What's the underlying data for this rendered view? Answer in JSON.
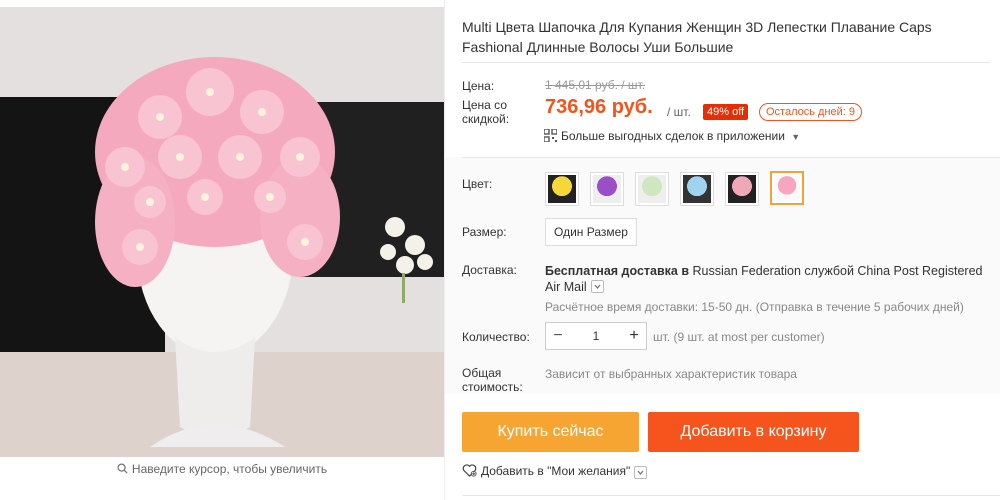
{
  "gallery": {
    "magnify_hint": "Наведите курсор, чтобы увеличить",
    "search_icon": "magnifier-icon"
  },
  "product": {
    "title": "Multi Цвета Шапочка Для Купания Женщин 3D Лепестки Плавание Caps Fashional Длинные Волосы Уши Большие"
  },
  "price": {
    "label_price": "Цена:",
    "old_price": "1 445,01 руб. / шт.",
    "label_discount_line1": "Цена со",
    "label_discount_line2": "скидкой:",
    "new_price": "736,96 руб.",
    "per_unit": "/ шт.",
    "discount_badge": "49% off",
    "days_left": "Осталось дней: 9",
    "app_deals": "Больше выгодных сделок в приложении"
  },
  "options": {
    "color_label": "Цвет:",
    "swatches": [
      {
        "name": "yellow",
        "color": "#f5d73a"
      },
      {
        "name": "purple",
        "color": "#9b4fc7"
      },
      {
        "name": "mint",
        "color": "#cfe7c1"
      },
      {
        "name": "blue",
        "color": "#9fd3ef"
      },
      {
        "name": "multicolor",
        "color": "#f0a7b6"
      },
      {
        "name": "pink",
        "color": "#f7a6c2"
      }
    ],
    "selected_index": 5,
    "size_label": "Размер:",
    "size_value": "Один Размер"
  },
  "shipping": {
    "label": "Доставка:",
    "bold_text": "Бесплатная доставка в",
    "rest_text": "Russian Federation службой China Post Registered Air Mail",
    "estimate": "Расчётное время доставки: 15-50 дн. (Отправка в течение 5 рабочих дней)"
  },
  "quantity": {
    "label": "Количество:",
    "value": "1",
    "minus": "−",
    "plus": "+",
    "note": "шт. (9 шт. at most per customer)"
  },
  "total": {
    "label_line1": "Общая",
    "label_line2": "стоимость:",
    "note": "Зависит от выбранных характеристик товара"
  },
  "actions": {
    "buy_now": "Купить сейчас",
    "add_to_cart": "Добавить в корзину",
    "wishlist": "Добавить в \"Мои желания\""
  },
  "colors": {
    "accent_orange": "#f5541d",
    "buy_orange": "#f7a532",
    "price_orange": "#f3531c"
  }
}
